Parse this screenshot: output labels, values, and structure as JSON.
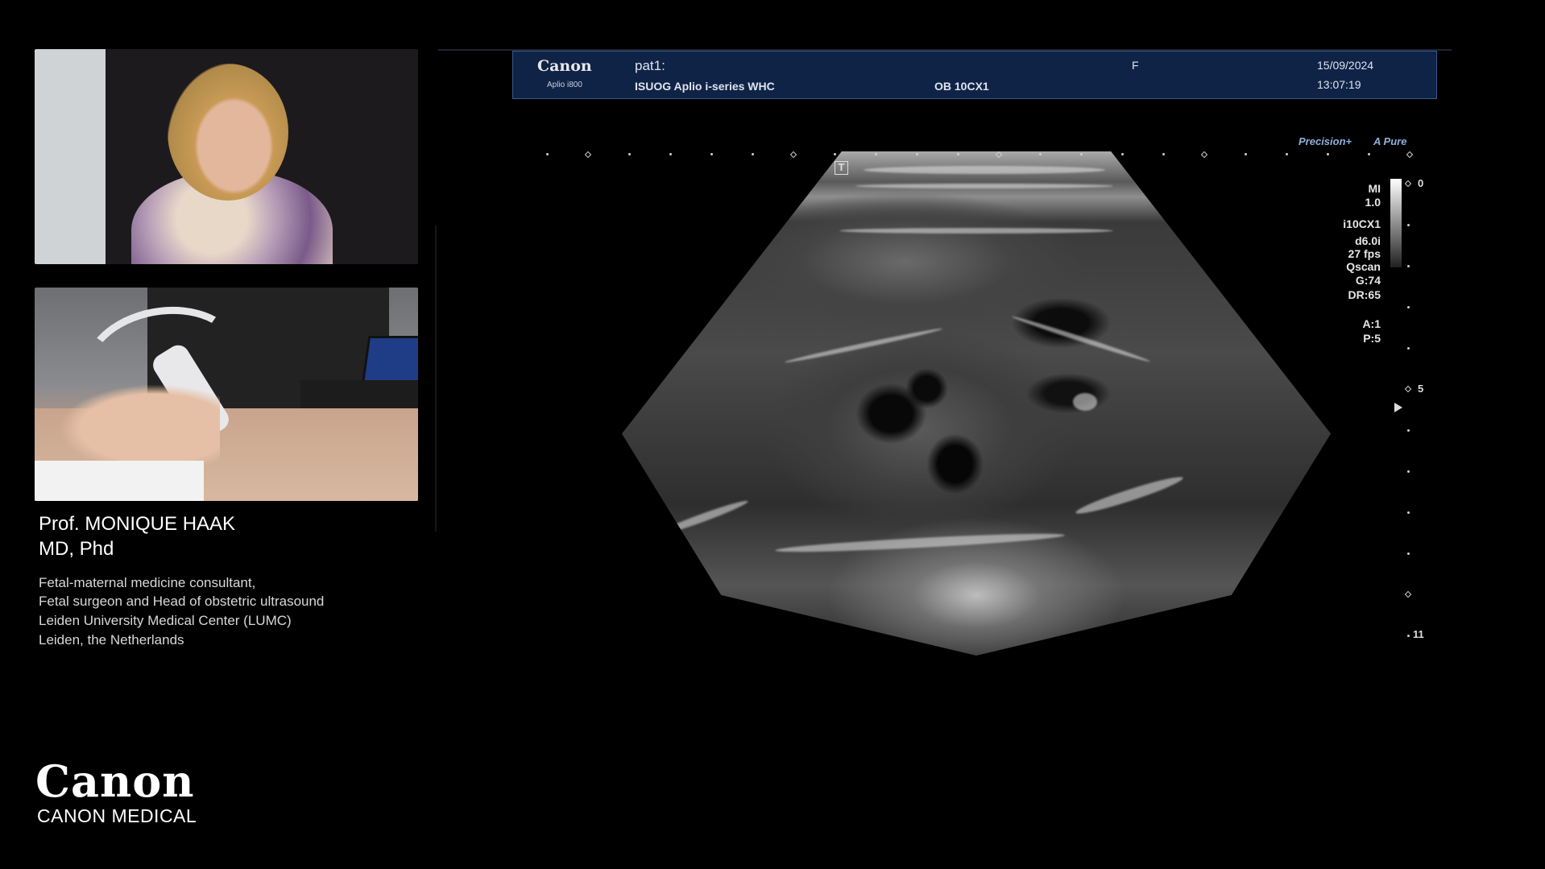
{
  "presenter": {
    "name": "Prof. MONIQUE HAAK",
    "degree": "MD, Phd",
    "lines": [
      "Fetal-maternal medicine consultant,",
      "Fetal surgeon and Head of obstetric ultrasound",
      "Leiden University Medical Center (LUMC)",
      "Leiden, the Netherlands"
    ]
  },
  "brand": {
    "logo": "Canon",
    "subtitle": "CANON MEDICAL"
  },
  "header": {
    "logo": "Canon",
    "model": "Aplio i800",
    "patient": "pat1:",
    "institution": "ISUOG Aplio i-series WHC",
    "preset": "OB 10CX1",
    "sex": "F",
    "date": "15/09/2024",
    "time": "13:07:19"
  },
  "overlay": {
    "t_marker": "T",
    "precision": "Precision+",
    "pure": "A Pure"
  },
  "params": [
    "MI",
    "1.0",
    "i10CX1",
    "d6.0i",
    "27 fps",
    "Qscan",
    "G:74",
    "DR:65",
    "",
    "A:1",
    "P:5"
  ],
  "depth": {
    "top": "0",
    "mid": "5",
    "bottom": "11"
  },
  "colors": {
    "header_bg": "#0f2347",
    "overlay_text": "#8fb0d8"
  }
}
